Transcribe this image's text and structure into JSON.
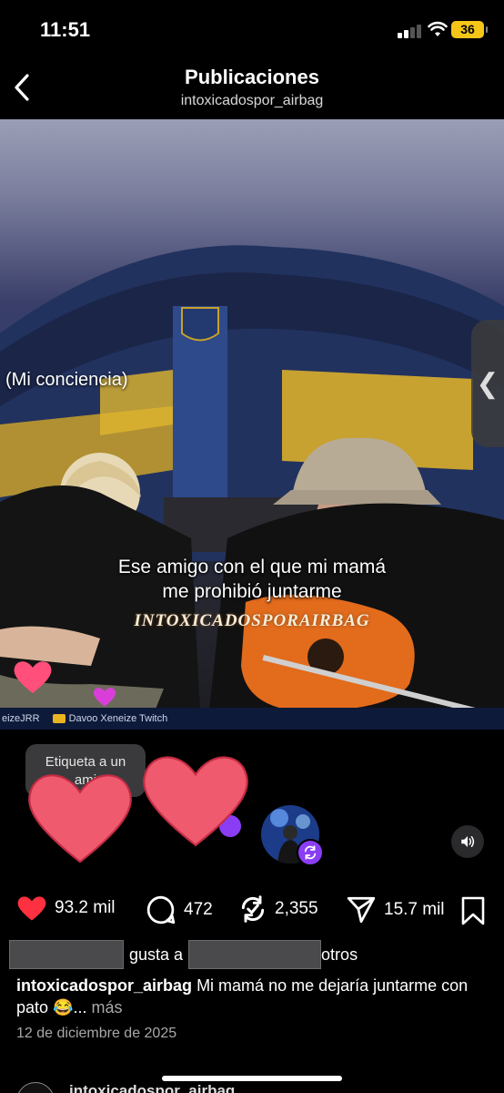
{
  "status_bar": {
    "time": "11:51",
    "battery": "36"
  },
  "header": {
    "title": "Publicaciones",
    "subtitle": "intoxicadospor_airbag"
  },
  "media": {
    "label": "(Mi conciencia)",
    "overlay_caption_line1": "Ese amigo con el que mi mamá",
    "overlay_caption_line2": "me prohibió juntarme",
    "watermark": "INTOXICADOSPORAIRBAG",
    "stream_left": "eizeJRR",
    "stream_right": "Davoo Xeneize Twitch"
  },
  "tag_prompt": {
    "line1": "Etiqueta a un",
    "line2": "ami"
  },
  "actions": {
    "likes": "93.2 mil",
    "comments": "472",
    "reposts": "2,355",
    "shares": "15.7 mil"
  },
  "likes_line": {
    "text1": "gusta a",
    "text2": "otros"
  },
  "caption": {
    "username": "intoxicadospor_airbag",
    "text": "Mi mamá no me dejaría juntarme con pato 😂...",
    "more": "más"
  },
  "post_date": "12 de diciembre de 2025",
  "next_post": {
    "username": "intoxicadospor_airbag"
  },
  "colors": {
    "like_red": "#ff3040",
    "repost_purple": "#8a3df5",
    "battery_yellow": "#f5c518"
  }
}
